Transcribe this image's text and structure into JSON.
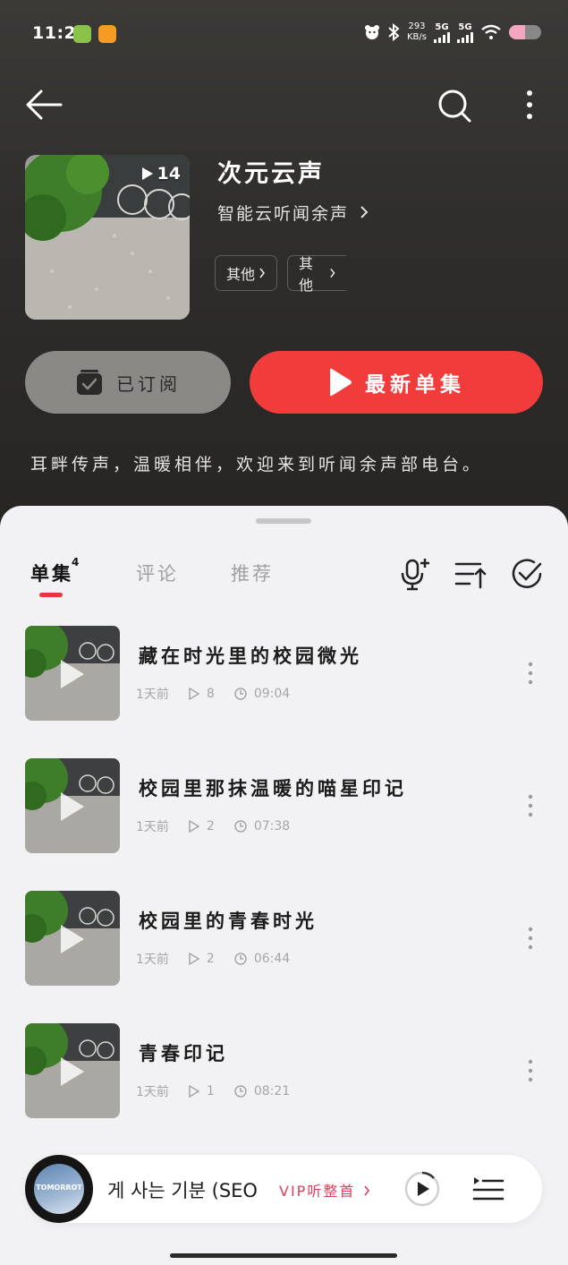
{
  "status_bar": {
    "time": "11:21",
    "net_speed_value": "293",
    "net_speed_unit": "KB/s",
    "signal1": "5G",
    "signal2": "5G"
  },
  "album": {
    "play_count": "14",
    "title": "次元云声",
    "author": "智能云听闻余声",
    "tags": [
      "其他",
      "其他"
    ],
    "subscribe_label": "已订阅",
    "latest_label": "最新单集",
    "description": "耳畔传声，温暖相伴，欢迎来到听闻余声部电台。"
  },
  "tabs": {
    "episodes_label": "单集",
    "episodes_count": "4",
    "comments_label": "评论",
    "recommend_label": "推荐"
  },
  "episodes": [
    {
      "title": "藏在时光里的校园微光",
      "date": "1天前",
      "plays": "8",
      "duration": "09:04"
    },
    {
      "title": "校园里那抹温暖的喵星印记",
      "date": "1天前",
      "plays": "2",
      "duration": "07:38"
    },
    {
      "title": "校园里的青春时光",
      "date": "1天前",
      "plays": "2",
      "duration": "06:44"
    },
    {
      "title": "青春印记",
      "date": "1天前",
      "plays": "1",
      "duration": "08:21"
    }
  ],
  "player": {
    "disc_label": "TOMORROT",
    "song": "게 사는 기분 (SEO",
    "vip_label": "VIP听整首"
  },
  "colors": {
    "accent_red": "#f23b3b",
    "indicator_red": "#ee3242",
    "vip_pink": "#e23d5e"
  },
  "icons": {
    "back": "arrow-left-icon",
    "search": "search-icon",
    "more": "more-vertical-icon",
    "mic_add": "mic-plus-icon",
    "sort": "sort-icon",
    "select": "check-circle-icon",
    "play": "play-icon",
    "playlist": "playlist-icon"
  }
}
